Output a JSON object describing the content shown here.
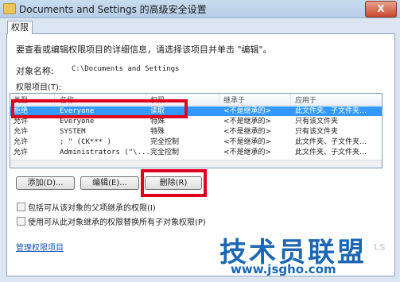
{
  "window": {
    "title": "Documents and Settings 的高级安全设置",
    "close_glyph": "X"
  },
  "tab": {
    "label": "权限"
  },
  "dialog": {
    "instruction": "要查看或编辑权限项目的详细信息，请选择该项目并单击 \"编辑\"。",
    "object_name_label": "对象名称:",
    "object_name_value": "C:\\Documents and Settings",
    "entries_label": "权限项目(T):"
  },
  "columns": [
    "类型",
    "名称",
    "权限",
    "继承于",
    "应用于"
  ],
  "rows": [
    {
      "type": "拒绝",
      "name": "Everyone",
      "permission": "读取",
      "inherited": "<不是继承的>",
      "applies": "此文件夹、子文件夹…",
      "selected": true
    },
    {
      "type": "允许",
      "name": "Everyone",
      "permission": "特殊",
      "inherited": "<不是继承的>",
      "applies": "只有该文件夹",
      "selected": false
    },
    {
      "type": "允许",
      "name": "SYSTEM",
      "permission": "特殊",
      "inherited": "<不是继承的>",
      "applies": "只有该文件夹",
      "selected": false
    },
    {
      "type": "允许",
      "name": "; \" (CK*** )",
      "permission": "完全控制",
      "inherited": "<不是继承的>",
      "applies": "此文件夹、子文件夹…",
      "selected": false
    },
    {
      "type": "允许",
      "name": "Administrators (\"\\...",
      "permission": "完全控制",
      "inherited": "<不是继承的>",
      "applies": "此文件夹、子文件夹…",
      "selected": false
    }
  ],
  "buttons": {
    "add": "添加(D)...",
    "edit": "编辑(E)...",
    "delete": "删除(R)"
  },
  "checkboxes": {
    "include_inheritable": "包括可从该对象的父项继承的权限(I)",
    "replace_child": "使用可从此对象继承的权限替换所有子对象权限(P)"
  },
  "link": {
    "manage_entries": "管理权限项目"
  },
  "watermark": {
    "main": "技术员联盟",
    "url": "www.jsgho.com",
    "logo": "LS"
  },
  "colors": {
    "highlight": "#e0001c",
    "selection": "#3399ff",
    "watermark": "#1b67b3"
  }
}
